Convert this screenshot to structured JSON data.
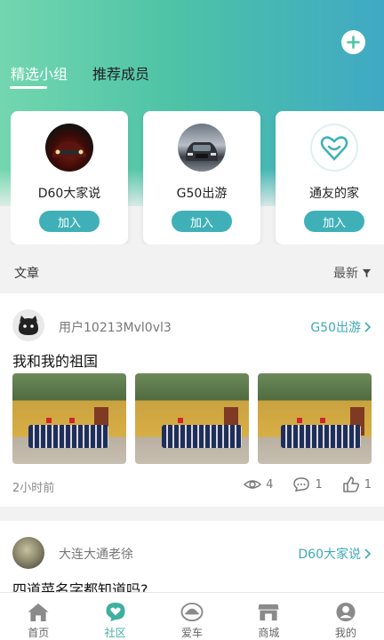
{
  "header": {
    "tabs": [
      {
        "label": "精选小组",
        "active": true
      },
      {
        "label": "推荐成员",
        "active": false
      }
    ]
  },
  "groups": [
    {
      "name": "D60大家说",
      "join_label": "加入"
    },
    {
      "name": "G50出游",
      "join_label": "加入"
    },
    {
      "name": "通友的家",
      "join_label": "加入"
    }
  ],
  "articles": {
    "title": "文章",
    "sort_label": "最新"
  },
  "posts": [
    {
      "user": "用户10213Mvl0vl3",
      "group": "G50出游",
      "title": "我和我的祖国",
      "time": "2小时前",
      "views": "4",
      "comments": "1",
      "likes": "1"
    },
    {
      "user": "大连大通老徐",
      "group": "D60大家说",
      "title": "四道菜名字都知道吗?"
    }
  ],
  "tabbar": [
    {
      "label": "首页",
      "icon": "home-icon"
    },
    {
      "label": "社区",
      "icon": "community-icon",
      "active": true
    },
    {
      "label": "爱车",
      "icon": "car-icon"
    },
    {
      "label": "商城",
      "icon": "store-icon"
    },
    {
      "label": "我的",
      "icon": "profile-icon"
    }
  ],
  "colors": {
    "accent": "#3fb0b8",
    "gradient_start": "#73d6b0",
    "gradient_end": "#3fa9c4"
  }
}
